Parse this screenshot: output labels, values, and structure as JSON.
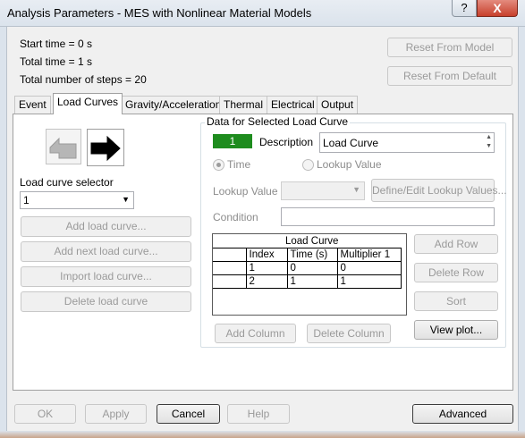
{
  "window": {
    "title": "Analysis Parameters - MES with Nonlinear Material Models",
    "help_label": "?",
    "close_label": "X"
  },
  "summary": {
    "start_time": "Start time = 0 s",
    "total_time": "Total time = 1 s",
    "total_steps": "Total number of steps = 20"
  },
  "reset": {
    "from_model": "Reset From Model",
    "from_default": "Reset From Default"
  },
  "tabs": [
    "Event",
    "Load Curves",
    "Gravity/Acceleration",
    "Thermal",
    "Electrical",
    "Output"
  ],
  "left": {
    "selector_label": "Load curve selector",
    "selector_value": "1",
    "buttons": [
      "Add load curve...",
      "Add next load curve...",
      "Import load curve...",
      "Delete load curve"
    ]
  },
  "group": {
    "title": "Data for Selected Load Curve",
    "curve_number": "1",
    "description_label": "Description",
    "description_value": "Load Curve",
    "radio_time": "Time",
    "radio_lookup": "Lookup Value",
    "lookup_label": "Lookup Value",
    "define_lookup": "Define/Edit Lookup Values...",
    "condition_label": "Condition",
    "table_title": "Load Curve",
    "columns": [
      "Index",
      "Time (s)",
      "Multiplier 1"
    ],
    "rows": [
      [
        "1",
        "0",
        "0"
      ],
      [
        "2",
        "1",
        "1"
      ]
    ],
    "add_row": "Add Row",
    "delete_row": "Delete Row",
    "sort": "Sort",
    "add_column": "Add Column",
    "delete_column": "Delete Column",
    "view_plot": "View plot..."
  },
  "footer": {
    "ok": "OK",
    "apply": "Apply",
    "cancel": "Cancel",
    "help": "Help",
    "advanced": "Advanced"
  },
  "colors": {
    "curve_badge": "#1e8c1e",
    "close_button": "#c7402c"
  }
}
